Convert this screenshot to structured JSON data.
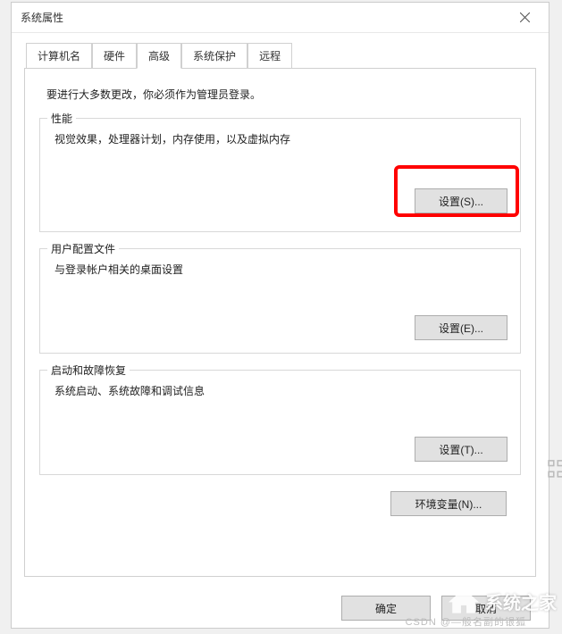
{
  "window": {
    "title": "系统属性",
    "close_icon": "close"
  },
  "tabs": [
    {
      "label": "计算机名"
    },
    {
      "label": "硬件"
    },
    {
      "label": "高级"
    },
    {
      "label": "系统保护"
    },
    {
      "label": "远程"
    }
  ],
  "active_tab_index": 2,
  "admin_note": "要进行大多数更改，你必须作为管理员登录。",
  "groups": {
    "performance": {
      "title": "性能",
      "desc": "视觉效果，处理器计划，内存使用，以及虚拟内存",
      "button": "设置(S)..."
    },
    "user_profiles": {
      "title": "用户配置文件",
      "desc": "与登录帐户相关的桌面设置",
      "button": "设置(E)..."
    },
    "startup": {
      "title": "启动和故障恢复",
      "desc": "系统启动、系统故障和调试信息",
      "button": "设置(T)..."
    }
  },
  "env_button": "环境变量(N)...",
  "bottom": {
    "ok": "确定",
    "cancel": "取消"
  },
  "watermark": {
    "brand": "系统之家",
    "csdn": "CSDN @—般名副的银狐"
  }
}
